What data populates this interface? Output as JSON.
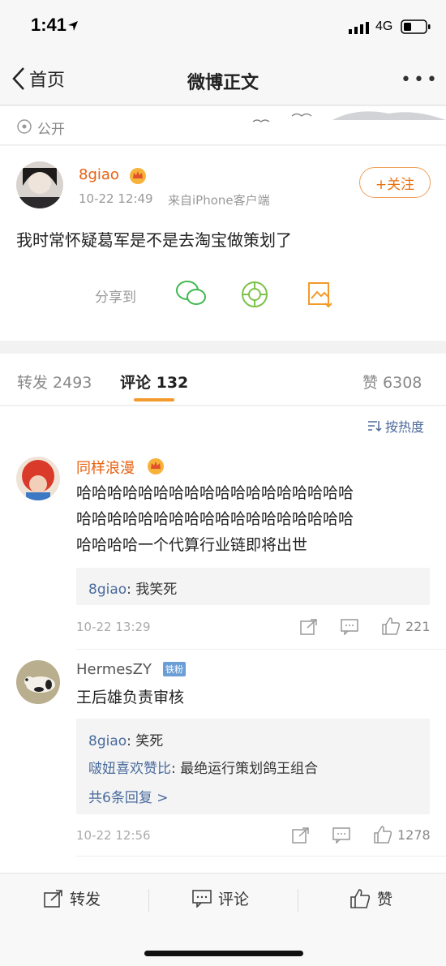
{
  "status_bar": {
    "time": "1:41",
    "network": "4G"
  },
  "nav": {
    "back_label": "首页",
    "title": "微博正文",
    "more": "•••"
  },
  "visibility": {
    "label": "公开"
  },
  "post": {
    "username": "8giao",
    "time": "10-22 12:49",
    "source": "来自iPhone客户端",
    "follow_label": "+关注",
    "text": "我时常怀疑葛军是不是去淘宝做策划了",
    "share_label": "分享到"
  },
  "tabs": {
    "repost": "转发 2493",
    "comment": "评论 132",
    "like": "赞 6308"
  },
  "sort": {
    "label": "按热度"
  },
  "comments": [
    {
      "name": "同样浪漫",
      "lines": [
        "哈哈哈哈哈哈哈哈哈哈哈哈哈哈哈哈哈哈",
        "哈哈哈哈哈哈哈哈哈哈哈哈哈哈哈哈哈哈",
        "哈哈哈哈一个代算行业链即将出世"
      ],
      "reply_user": "8giao",
      "reply_text": ": 我笑死",
      "time": "10-22 13:29",
      "likes": "221"
    },
    {
      "name": "HermesZY",
      "badge": "铁粉",
      "text": "王后雄负责审核",
      "reply1_user": "8giao",
      "reply1_text": ": 笑死",
      "reply2_user": "啵妞喜欢赞比",
      "reply2_text": ": 最绝运行策划鸽王组合",
      "more_replies": "共6条回复 >",
      "time": "10-22 12:56",
      "likes": "1278"
    }
  ],
  "bottom_bar": {
    "repost": "转发",
    "comment": "评论",
    "like": "赞"
  },
  "colors": {
    "accent": "#e8600f",
    "link": "#4a6b9d",
    "tab_underline": "#f39a2c"
  }
}
